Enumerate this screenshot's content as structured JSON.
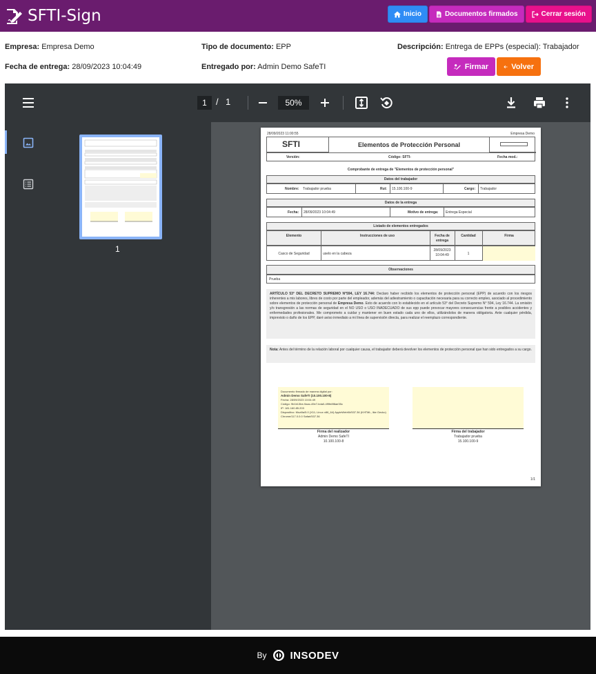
{
  "app": {
    "title": "SFTI-Sign"
  },
  "nav": {
    "inicio": "Inicio",
    "documentos": "Documentos firmados",
    "cerrar": "Cerrar sesión"
  },
  "info": {
    "empresa_label": "Empresa:",
    "empresa_value": "Empresa Demo",
    "tipo_label": "Tipo de documento:",
    "tipo_value": "EPP",
    "desc_label": "Descripción:",
    "desc_value": "Entrega de EPPs (especial): Trabajador",
    "fecha_label": "Fecha de entrega:",
    "fecha_value": "28/09/2023 10:04:49",
    "entregado_label": "Entregado por:",
    "entregado_value": "Admin Demo SafeTI"
  },
  "actions": {
    "firmar": "Firmar",
    "volver": "Volver"
  },
  "viewer": {
    "page_current": "1",
    "page_sep": "/",
    "page_total": "1",
    "zoom": "50%",
    "thumb_label": "1"
  },
  "doc": {
    "timestamp": "28/09/2023 11:00:55",
    "company": "Empresa Demo",
    "logo": "SFTI",
    "title": "Elementos de Protección Personal",
    "version_label": "Versión:",
    "codigo_label": "Código: SFTI-",
    "fecha_mod_label": "Fecha mod.:",
    "comprobante": "Comprobante de entrega de \"Elementos de protección personal\"",
    "datos_trabajador": "Datos del trabajador",
    "nombre_label": "Nombre:",
    "nombre_value": "Trabajador prueba",
    "rut_label": "Rut:",
    "rut_value": "15.100.100-9",
    "cargo_label": "Cargo:",
    "cargo_value": "Trabajador",
    "datos_entrega": "Datos de la entrega",
    "fecha_label": "Fecha:",
    "fecha_value": "28/09/2023 10:04:49",
    "motivo_label": "Motivo de entrega:",
    "motivo_value": "Entrega Especial",
    "listado": "Listado de elementos entregados",
    "col_elemento": "Elemento",
    "col_instrucciones": "Instrucciones de uso",
    "col_fecha": "Fecha de entrega",
    "col_cantidad": "Cantidad",
    "col_firma": "Firma",
    "row_elemento": "Casco de Seguridad",
    "row_instrucciones": "uselo en la cabeza",
    "row_fecha": "28/09/2023 10:04:49",
    "row_cantidad": "1",
    "observaciones": "Observaciones",
    "observaciones_value": "Prueba",
    "articulo_bold": "ARTÍCULO 53° DEL DECRETO SUPREMO N°594, LEY 16.744:",
    "articulo_text": "Declaro haber recibido los elementos de protección personal (EPP) de acuerdo con los riesgos inherentes a mis labores, libres de costo por parte del empleador, además del adiestramiento o capacitación necesaria para su correcto empleo, asociado al procedimiento sobre elementos de protección personal de",
    "articulo_company": "Empresa Demo",
    "articulo_text2": ". Esto de acuerdo con lo establecido en el artículo 53° del Decreto Supremo N° 594, Ley 16.744. La omisión y/o transgresión a las normas de seguridad en el NO USO o USO INADECUADO de sus epp puede provocar mayores consecuencias frente a posibles accidentes y enfermedades profesionales. Me comprometo a cuidar y mantener en buen estado cada uno de ellos, utilizándolos de manera obligatoria. Ante cualquier pérdida, imprevisto o daño de los EPP, daré aviso inmediato a mi línea de supervisión directa, para realizar el reemplazo correspondiente.",
    "nota_bold": "Nota:",
    "nota_text": "Antes del término de la relación laboral por cualquier causa, el trabajador deberá devolver los elementos de protección personal que han sido entregados a su cargo.",
    "sig1_line1": "Documento firmado de manera digital por:",
    "sig1_line2": "Admin Demo SafeTI (10.100.100-8)",
    "sig1_fecha": "Fecha: 28/09/2023 10:04:49",
    "sig1_codigo": "Código: 9b1b13be-9aac-49e7-bda0-4f9fe8f8ae35c",
    "sig1_ip": "IP: 181.160.85.203",
    "sig1_disp": "Dispositivo: Mozilla/5.0 (X11; Linux x86_64) AppleWebKit/537.36 (KHTML, like Gecko) Chrome/117.0.0.0 Safari/537.36",
    "sig1_title": "Firma del realizador",
    "sig1_name": "Admin Demo SafeTI",
    "sig1_rut": "10.100.100-8",
    "sig2_title": "Firma del trabajador",
    "sig2_name": "Trabajador prueba",
    "sig2_rut": "15.100.100-9",
    "page_num": "1/1"
  },
  "footer": {
    "by": "By",
    "brand": "INSODEV"
  },
  "colors": {
    "topbar": "#6a1c6e",
    "blue": "#2f8cf5",
    "purple": "#c52bbd",
    "pink": "#e8118c",
    "orange": "#f6710f"
  },
  "icons": [
    "signature-icon",
    "home-icon",
    "file-icon",
    "logout-icon",
    "pen-icon",
    "arrow-left-icon",
    "menu-icon",
    "minus-icon",
    "plus-icon",
    "fit-page-icon",
    "rotate-icon",
    "download-icon",
    "print-icon",
    "more-icon",
    "image-icon",
    "outline-icon"
  ]
}
